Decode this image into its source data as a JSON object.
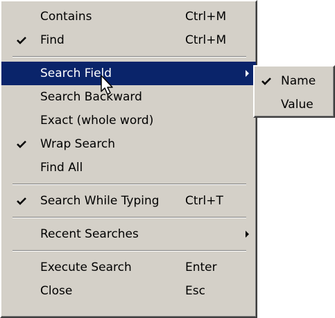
{
  "menu": {
    "items": [
      {
        "label": "Contains",
        "shortcut": "Ctrl+M",
        "checked": false
      },
      {
        "label": "Find",
        "shortcut": "Ctrl+M",
        "checked": true
      },
      {
        "label": "Search Field",
        "shortcut": "",
        "checked": false,
        "submenu": true,
        "highlighted": true
      },
      {
        "label": "Search Backward",
        "shortcut": "",
        "checked": false
      },
      {
        "label": "Exact (whole word)",
        "shortcut": "",
        "checked": false
      },
      {
        "label": "Wrap Search",
        "shortcut": "",
        "checked": true
      },
      {
        "label": "Find All",
        "shortcut": "",
        "checked": false
      },
      {
        "label": "Search While Typing",
        "shortcut": "Ctrl+T",
        "checked": true
      },
      {
        "label": "Recent Searches",
        "shortcut": "",
        "checked": false,
        "submenu": true
      },
      {
        "label": "Execute Search",
        "shortcut": "Enter",
        "checked": false
      },
      {
        "label": "Close",
        "shortcut": "Esc",
        "checked": false
      }
    ]
  },
  "submenu": {
    "items": [
      {
        "label": "Name",
        "checked": true
      },
      {
        "label": "Value",
        "checked": false
      }
    ]
  },
  "colors": {
    "menu_bg": "#d4d0c8",
    "highlight_bg": "#0a246a",
    "highlight_text": "#ffffff"
  },
  "icons": {
    "check": "checkmark-icon",
    "submenu_arrow": "submenu-arrow-icon",
    "cursor": "mouse-cursor-icon"
  }
}
